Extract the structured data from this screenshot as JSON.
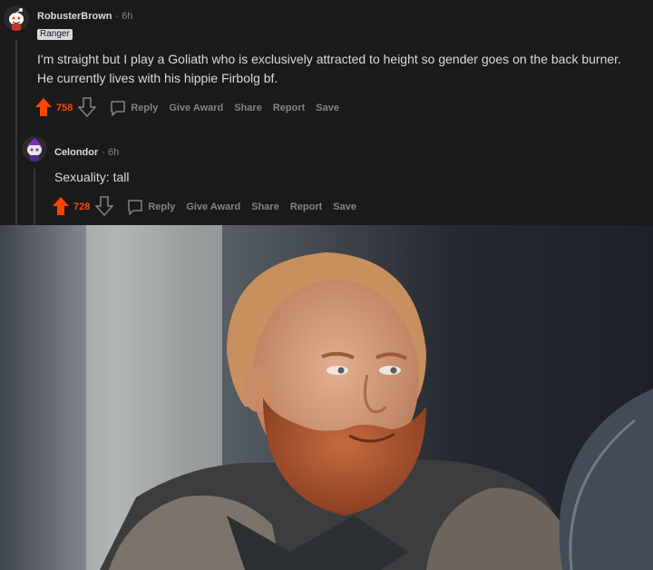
{
  "comment1": {
    "username": "RobusterBrown",
    "time": "· 6h",
    "flair": "Ranger",
    "body": "I'm straight but I play a Goliath who is exclusively attracted to height so gender goes on the back burner. He currently lives with his hippie Firbolg bf.",
    "score": "758",
    "actions": {
      "reply": "Reply",
      "award": "Give Award",
      "share": "Share",
      "report": "Report",
      "save": "Save"
    }
  },
  "comment2": {
    "username": "Celondor",
    "time": "· 6h",
    "body": "Sexuality: tall",
    "score": "728",
    "actions": {
      "reply": "Reply",
      "award": "Give Award",
      "share": "Share",
      "report": "Report",
      "save": "Save"
    }
  },
  "colors": {
    "upvote": "#ff4500",
    "background": "#1a1a1b",
    "text": "#d7dadc",
    "muted": "#818384"
  }
}
